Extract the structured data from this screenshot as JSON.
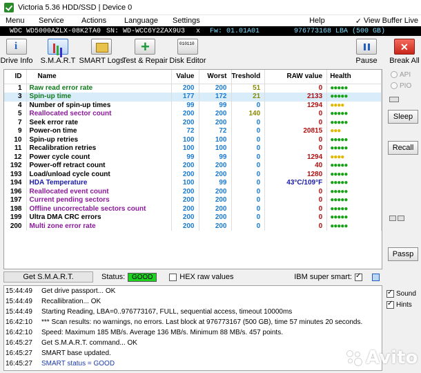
{
  "window": {
    "title": "Victoria 5.36 HDD/SSD | Device 0"
  },
  "menu": {
    "left": [
      "Menu",
      "Service",
      "Actions",
      "Language",
      "Settings"
    ],
    "help": "Help",
    "view_buffer": "View Buffer Live"
  },
  "drive_info": {
    "model": "WDC WD5000AZLX-08K2TA0",
    "serial": "SN: WD-WCC6Y2ZAX9U3",
    "x": "x",
    "firmware": "Fw: 01.01A01",
    "lba": "976773168 LBA (500 GB)"
  },
  "toolbar": {
    "drive_info": "Drive Info",
    "smart": "S.M.A.R.T",
    "smart_logs": "SMART Logs",
    "test_repair": "Test & Repair",
    "disk_editor": "Disk Editor",
    "pause": "Pause",
    "break_all": "Break All"
  },
  "table": {
    "headers": [
      "ID",
      "Name",
      "Value",
      "Worst",
      "Treshold",
      "RAW value",
      "Health"
    ],
    "rows": [
      {
        "id": "1",
        "name": "Raw read error rate",
        "value": "200",
        "worst": "200",
        "treshold": "51",
        "raw": "0",
        "health": "●●●●●"
      },
      {
        "id": "3",
        "name": "Spin-up time",
        "value": "177",
        "worst": "172",
        "treshold": "21",
        "raw": "2133",
        "health": "●●●●●"
      },
      {
        "id": "4",
        "name": "Number of spin-up times",
        "value": "99",
        "worst": "99",
        "treshold": "0",
        "raw": "1294",
        "health": "●●●●"
      },
      {
        "id": "5",
        "name": "Reallocated sector count",
        "value": "200",
        "worst": "200",
        "treshold": "140",
        "raw": "0",
        "health": "●●●●●"
      },
      {
        "id": "7",
        "name": "Seek error rate",
        "value": "200",
        "worst": "200",
        "treshold": "0",
        "raw": "0",
        "health": "●●●●●"
      },
      {
        "id": "9",
        "name": "Power-on time",
        "value": "72",
        "worst": "72",
        "treshold": "0",
        "raw": "20815",
        "health": "●●●"
      },
      {
        "id": "10",
        "name": "Spin-up retries",
        "value": "100",
        "worst": "100",
        "treshold": "0",
        "raw": "0",
        "health": "●●●●●"
      },
      {
        "id": "11",
        "name": "Recalibration retries",
        "value": "100",
        "worst": "100",
        "treshold": "0",
        "raw": "0",
        "health": "●●●●●"
      },
      {
        "id": "12",
        "name": "Power cycle count",
        "value": "99",
        "worst": "99",
        "treshold": "0",
        "raw": "1294",
        "health": "●●●●"
      },
      {
        "id": "192",
        "name": "Power-off retract count",
        "value": "200",
        "worst": "200",
        "treshold": "0",
        "raw": "40",
        "health": "●●●●●"
      },
      {
        "id": "193",
        "name": "Load/unload cycle count",
        "value": "200",
        "worst": "200",
        "treshold": "0",
        "raw": "1280",
        "health": "●●●●●"
      },
      {
        "id": "194",
        "name": "HDA Temperature",
        "value": "100",
        "worst": "99",
        "treshold": "0",
        "raw": "43°C/109°F",
        "health": "●●●●●"
      },
      {
        "id": "196",
        "name": "Reallocated event count",
        "value": "200",
        "worst": "200",
        "treshold": "0",
        "raw": "0",
        "health": "●●●●●"
      },
      {
        "id": "197",
        "name": "Current pending sectors",
        "value": "200",
        "worst": "200",
        "treshold": "0",
        "raw": "0",
        "health": "●●●●●"
      },
      {
        "id": "198",
        "name": "Offline uncorrectable sectors count",
        "value": "200",
        "worst": "200",
        "treshold": "0",
        "raw": "0",
        "health": "●●●●●"
      },
      {
        "id": "199",
        "name": "Ultra DMA CRC errors",
        "value": "200",
        "worst": "200",
        "treshold": "0",
        "raw": "0",
        "health": "●●●●●"
      },
      {
        "id": "200",
        "name": "Multi zone error rate",
        "value": "200",
        "worst": "200",
        "treshold": "0",
        "raw": "0",
        "health": "●●●●●"
      }
    ]
  },
  "status": {
    "get_smart": "Get S.M.A.R.T.",
    "status_label": "Status:",
    "status_value": "GOOD",
    "hex_raw": "HEX raw values",
    "ibm_super": "IBM super smart:"
  },
  "side": {
    "api": "API",
    "pio": "PIO",
    "sleep": "Sleep",
    "recall": "Recall",
    "passp": "Passp",
    "sound": "Sound",
    "hints": "Hints"
  },
  "log": [
    {
      "time": "15:44:49",
      "msg": "Get drive passport... OK",
      "blue": false
    },
    {
      "time": "15:44:49",
      "msg": "Recallibration... OK",
      "blue": false
    },
    {
      "time": "15:44:49",
      "msg": "Starting Reading, LBA=0..976773167, FULL, sequential access, timeout 10000ms",
      "blue": false
    },
    {
      "time": "16:42:10",
      "msg": "*** Scan results: no warnings, no errors. Last block at 976773167 (500 GB), time 57 minutes 20 seconds.",
      "blue": false
    },
    {
      "time": "16:42:10",
      "msg": "Speed: Maximum 185 MB/s. Average 136 MB/s. Minimum 88 MB/s. 457 points.",
      "blue": false
    },
    {
      "time": "16:45:27",
      "msg": "Get S.M.A.R.T. command... OK",
      "blue": false
    },
    {
      "time": "16:45:27",
      "msg": "SMART base updated.",
      "blue": false
    },
    {
      "time": "16:45:27",
      "msg": "SMART status = GOOD",
      "blue": true
    }
  ],
  "watermark": {
    "text": "Avito"
  },
  "colors": {
    "status_good": "#1fd21f",
    "accent": "#1e5fbf",
    "selected_row": "#d9ecfa"
  }
}
